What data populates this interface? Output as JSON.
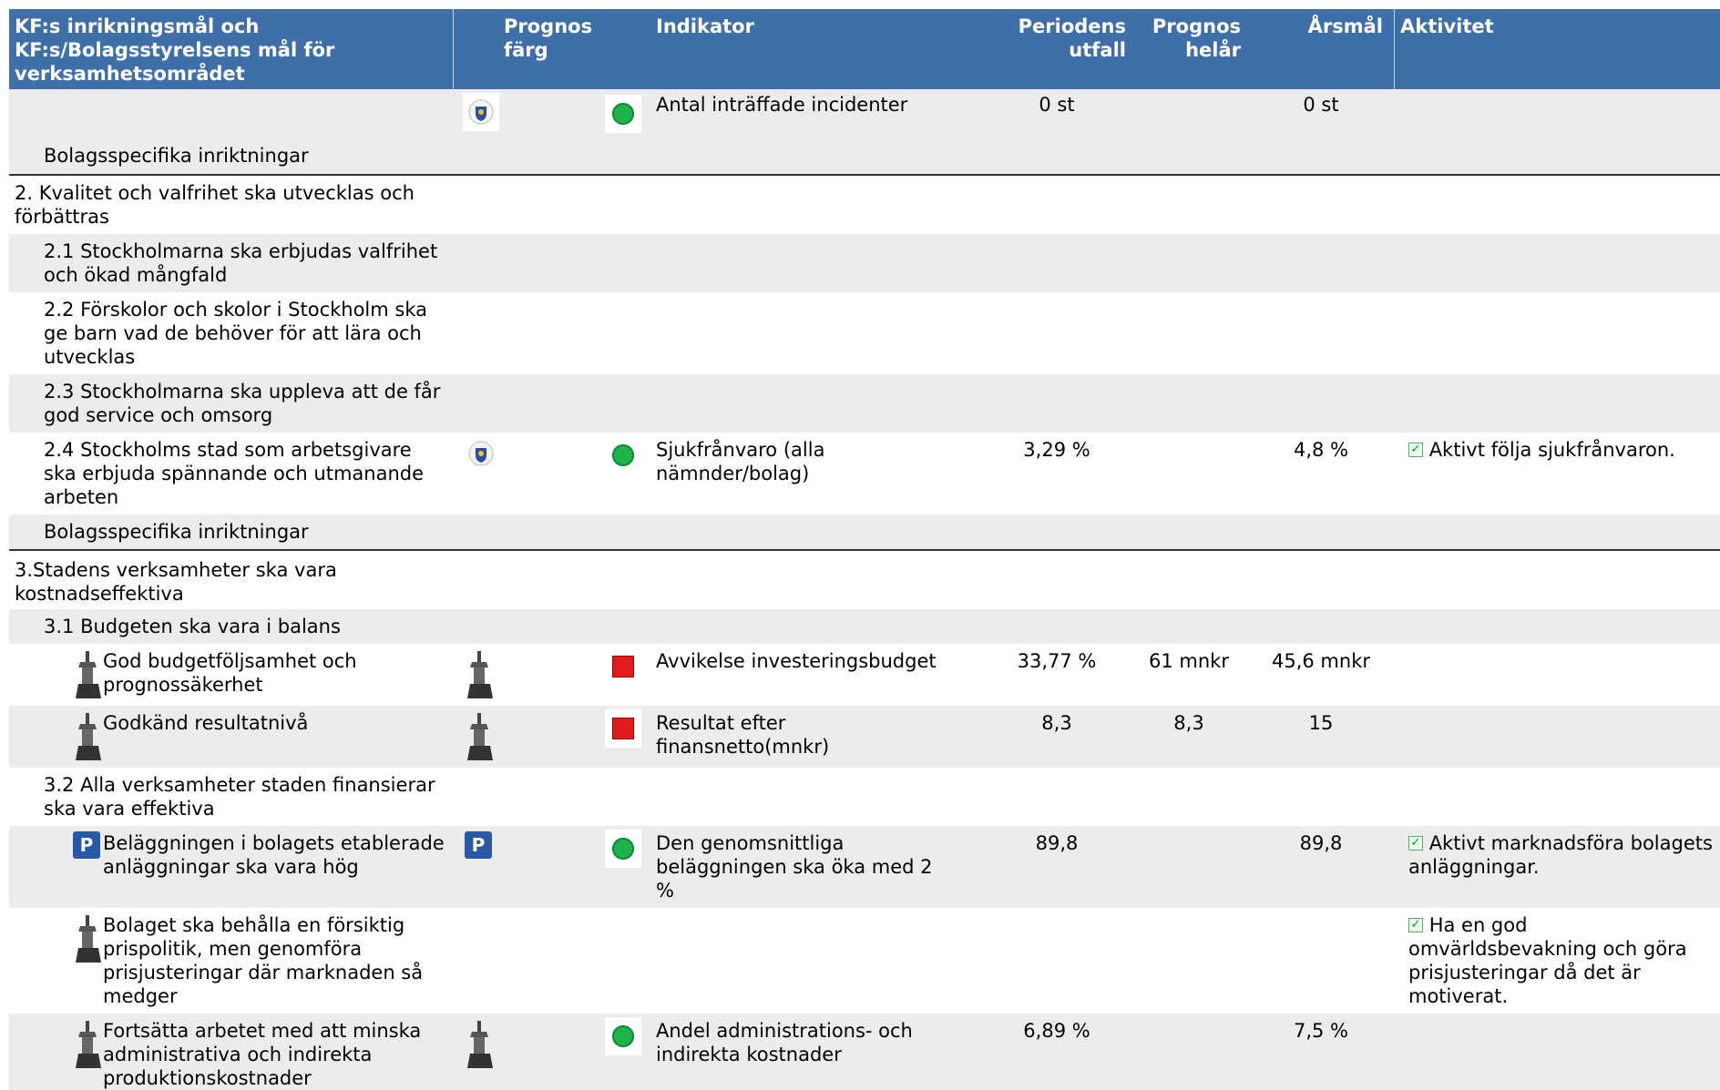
{
  "header": {
    "goal": "KF:s inrikningsmål och KF:s/Bolagsstyrelsens mål för verksamhetsområdet",
    "prognos_farg": "Prognos färg",
    "indikator": "Indikator",
    "periodens_utfall": "Periodens utfall",
    "prognos_helar": "Prognos helår",
    "arsmal": "Årsmål",
    "aktivitet": "Aktivitet"
  },
  "rows": {
    "r1": {
      "indicator": "Antal inträffade incidenter",
      "utfall": "0 st",
      "arsmal": "0 st"
    },
    "r2": {
      "label": "Bolagsspecifika inriktningar"
    },
    "r3": {
      "label": "2. Kvalitet och valfrihet ska utvecklas och förbättras"
    },
    "r4": {
      "label": "2.1 Stockholmarna ska erbjudas valfrihet och ökad mångfald"
    },
    "r5": {
      "label": "2.2 Förskolor och skolor i Stockholm ska ge barn vad de behöver för att lära och utvecklas"
    },
    "r6": {
      "label": "2.3 Stockholmarna ska uppleva att de får god service och omsorg"
    },
    "r7": {
      "label": "2.4 Stockholms stad som arbetsgivare ska erbjuda spännande och utmanande arbeten",
      "indicator": "Sjukfrånvaro (alla nämnder/bolag)",
      "utfall": "3,29 %",
      "arsmal": "4,8 %",
      "activity": "Aktivt följa sjukfrånvaron."
    },
    "r8": {
      "label": "Bolagsspecifika inriktningar"
    },
    "r9": {
      "label": "3.Stadens verksamheter ska vara kostnadseffektiva"
    },
    "r10": {
      "label": "3.1 Budgeten ska vara i balans"
    },
    "r11": {
      "label": "God budgetföljsamhet och prognossäkerhet",
      "indicator": "Avvikelse investeringsbudget",
      "utfall": "33,77 %",
      "prognos": "61 mnkr",
      "arsmal": "45,6 mnkr"
    },
    "r12": {
      "label": "Godkänd resultatnivå",
      "indicator": "Resultat efter finansnetto(mnkr)",
      "utfall": "8,3",
      "prognos": "8,3",
      "arsmal": "15"
    },
    "r13": {
      "label": "3.2 Alla verksamheter staden finansierar ska vara effektiva"
    },
    "r14": {
      "label": "Beläggningen i bolagets etablerade anläggningar ska vara hög",
      "badge": "P",
      "indicator": "Den genomsnittliga beläggningen ska öka med 2 %",
      "utfall": "89,8",
      "arsmal": "89,8",
      "activity": "Aktivt marknadsföra bolagets anläggningar."
    },
    "r15": {
      "label": "Bolaget ska behålla en försiktig prispolitik, men genomföra prisjusteringar där marknaden så medger",
      "activity": "Ha en god omvärldsbevakning och göra prisjusteringar då det är motiverat."
    },
    "r16": {
      "label": "Fortsätta arbetet med att minska administrativa och indirekta produktionskostnader",
      "indicator": "Andel administrations- och indirekta kostnader",
      "utfall": "6,89 %",
      "arsmal": "7,5 %"
    }
  },
  "colors": {
    "header_bg": "#3f6fa9",
    "row_gray": "#ececec",
    "green": "#1db54a",
    "red": "#e01b1b",
    "badge_blue": "#2958a6"
  },
  "icons": {
    "crest": "stockholm-crest-icon",
    "tower": "tower-icon",
    "status_green": "green-status-icon",
    "status_red": "red-status-icon",
    "check": "checkbox-icon"
  }
}
